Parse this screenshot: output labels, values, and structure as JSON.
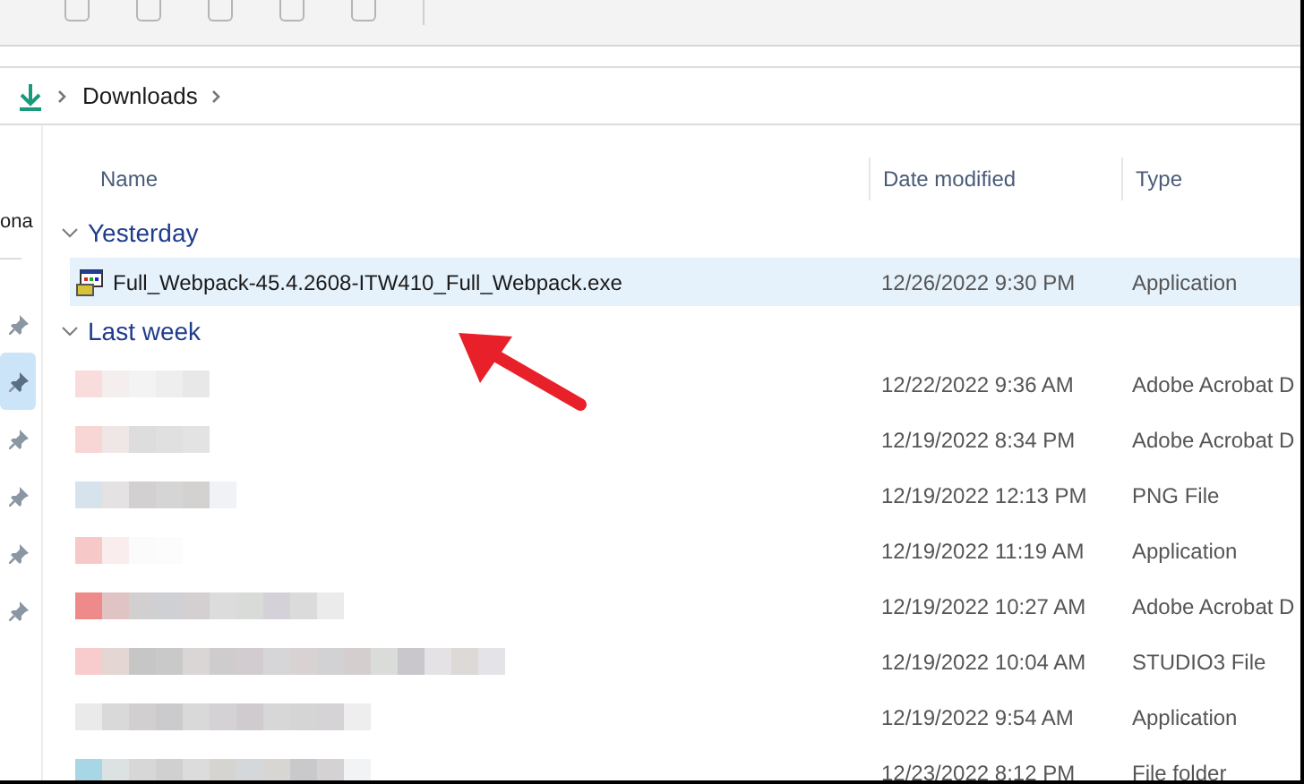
{
  "sidebar": {
    "cut_label": "ona",
    "items": [
      {
        "selected": false
      },
      {
        "selected": true
      },
      {
        "selected": false
      },
      {
        "selected": false
      },
      {
        "selected": false
      },
      {
        "selected": false
      }
    ]
  },
  "breadcrumb": {
    "items": [
      "Downloads"
    ]
  },
  "columns": [
    "Name",
    "Date modified",
    "Type"
  ],
  "groups": [
    {
      "label": "Yesterday",
      "expanded": true,
      "rows": [
        {
          "name": "Full_Webpack-45.4.2608-ITW410_Full_Webpack.exe",
          "date": "12/26/2022 9:30 PM",
          "type": "Application",
          "selected": true
        }
      ]
    },
    {
      "label": "Last week",
      "expanded": true,
      "rows": [
        {
          "date": "12/22/2022 9:36 AM",
          "type": "Adobe Acrobat D",
          "selected": false
        },
        {
          "date": "12/19/2022 8:34 PM",
          "type": "Adobe Acrobat D",
          "selected": false
        },
        {
          "date": "12/19/2022 12:13 PM",
          "type": "PNG File",
          "selected": false
        },
        {
          "date": "12/19/2022 11:19 AM",
          "type": "Application",
          "selected": false
        },
        {
          "date": "12/19/2022 10:27 AM",
          "type": "Adobe Acrobat D",
          "selected": false
        },
        {
          "date": "12/19/2022 10:04 AM",
          "type": "STUDIO3 File",
          "selected": false
        },
        {
          "date": "12/19/2022 9:54 AM",
          "type": "Application",
          "selected": false
        },
        {
          "date": "12/23/2022 8:12 PM",
          "type": "File folder",
          "selected": false
        }
      ]
    }
  ]
}
